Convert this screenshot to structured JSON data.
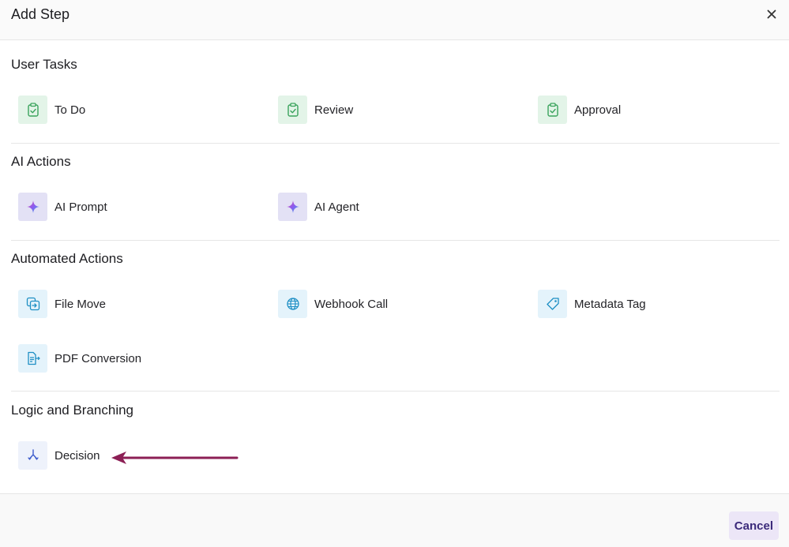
{
  "dialog": {
    "title": "Add Step"
  },
  "sections": [
    {
      "title": "User Tasks",
      "items": [
        {
          "label": "To Do",
          "icon": "clipboard-check-icon"
        },
        {
          "label": "Review",
          "icon": "clipboard-check-icon"
        },
        {
          "label": "Approval",
          "icon": "clipboard-check-icon"
        }
      ]
    },
    {
      "title": "AI Actions",
      "items": [
        {
          "label": "AI Prompt",
          "icon": "sparkle-icon"
        },
        {
          "label": "AI Agent",
          "icon": "sparkle-icon"
        }
      ]
    },
    {
      "title": "Automated Actions",
      "items": [
        {
          "label": "File Move",
          "icon": "file-move-icon"
        },
        {
          "label": "Webhook Call",
          "icon": "globe-icon"
        },
        {
          "label": "Metadata Tag",
          "icon": "tag-icon"
        },
        {
          "label": "PDF Conversion",
          "icon": "file-convert-icon"
        }
      ]
    },
    {
      "title": "Logic and Branching",
      "items": [
        {
          "label": "Decision",
          "icon": "branch-icon"
        }
      ]
    }
  ],
  "footer": {
    "cancel_label": "Cancel"
  },
  "colors": {
    "accent": "#3b2a7a",
    "cancel_bg": "#ece6f7",
    "annotation_arrow": "#8c1f55",
    "user_task_icon": "#3aa35c",
    "automation_icon": "#1e8fc4",
    "logic_icon": "#3d5ccc"
  }
}
